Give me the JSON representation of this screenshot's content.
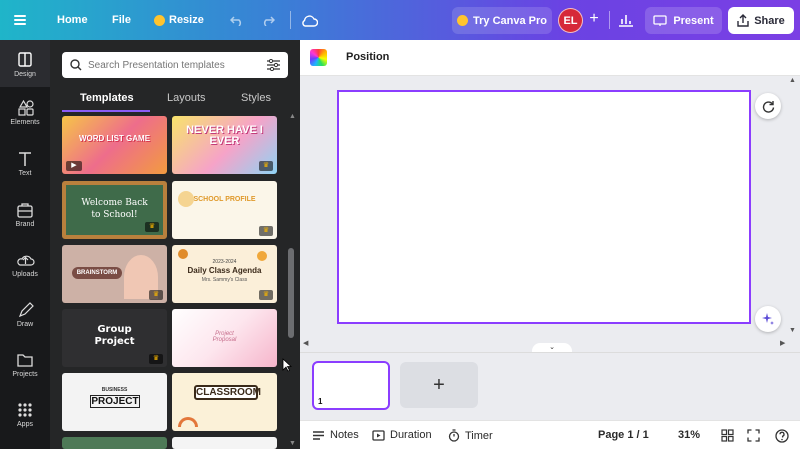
{
  "topbar": {
    "home": "Home",
    "file": "File",
    "resize": "Resize",
    "try_pro": "Try Canva Pro",
    "avatar_initials": "EL",
    "add": "+",
    "present": "Present",
    "share": "Share"
  },
  "rail": {
    "items": [
      {
        "label": "Design",
        "icon": "design-icon"
      },
      {
        "label": "Elements",
        "icon": "elements-icon"
      },
      {
        "label": "Text",
        "icon": "text-icon"
      },
      {
        "label": "Brand",
        "icon": "brand-icon"
      },
      {
        "label": "Uploads",
        "icon": "upload-icon"
      },
      {
        "label": "Draw",
        "icon": "draw-icon"
      },
      {
        "label": "Projects",
        "icon": "folder-icon"
      },
      {
        "label": "Apps",
        "icon": "apps-icon"
      }
    ]
  },
  "panel": {
    "search_placeholder": "Search Presentation templates",
    "tabs": [
      "Templates",
      "Layouts",
      "Styles"
    ],
    "templates": [
      {
        "title": "WORD LIST GAME",
        "colors": [
          "#f7c24a",
          "#e94e77"
        ]
      },
      {
        "title": "NEVER HAVE I EVER",
        "colors": [
          "#f6d743",
          "#f08fc0"
        ]
      },
      {
        "title": "Welcome Back to School!",
        "colors": [
          "#3f6b4a",
          "#c58b3b"
        ]
      },
      {
        "title": "SCHOOL PROFILE",
        "colors": [
          "#fbf6e9",
          "#e6a54a"
        ]
      },
      {
        "title": "BRAINSTORM",
        "colors": [
          "#c9a9a0",
          "#6b4b44"
        ]
      },
      {
        "title": "Daily Class Agenda",
        "subtitle": "2023-2024",
        "subtitle2": "Mrs. Sammy's Class",
        "colors": [
          "#fbefd9",
          "#e09a2c"
        ]
      },
      {
        "title": "Group Project",
        "colors": [
          "#2d2d2d",
          "#e0e0e0"
        ]
      },
      {
        "title": "Project Proposal",
        "colors": [
          "#fce8ef",
          "#f2a6c0"
        ]
      },
      {
        "title": "PROJECT",
        "subtitle": "BUSINESS",
        "colors": [
          "#f2f2f2",
          "#2b2b2b"
        ]
      },
      {
        "title": "CLASSROOM",
        "colors": [
          "#fbf1d8",
          "#d88a2b"
        ]
      }
    ]
  },
  "toolbar": {
    "position": "Position"
  },
  "filmstrip": {
    "page_number": "1",
    "add": "+"
  },
  "bottombar": {
    "notes": "Notes",
    "duration": "Duration",
    "timer": "Timer",
    "page": "Page 1 / 1",
    "zoom": "31%"
  }
}
